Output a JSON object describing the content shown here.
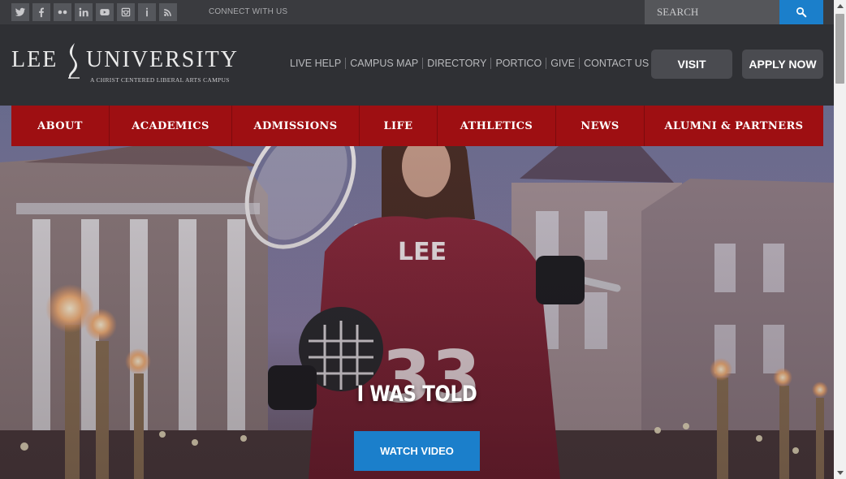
{
  "topbar": {
    "social_icons": [
      "twitter-icon",
      "facebook-icon",
      "flickr-icon",
      "linkedin-icon",
      "youtube-icon",
      "instagram-icon",
      "portico-icon",
      "rss-icon"
    ],
    "connect_label": "CONNECT WITH US",
    "search_placeholder": "SEARCH",
    "search_icon": "search-icon"
  },
  "header": {
    "logo_left": "LEE",
    "logo_right": "UNIVERSITY",
    "logo_tagline": "A CHRIST CENTERED LIBERAL ARTS CAMPUS",
    "links": [
      "LIVE HELP",
      "CAMPUS MAP",
      "DIRECTORY",
      "PORTICO",
      "GIVE",
      "CONTACT US"
    ],
    "visit_label": "VISIT",
    "apply_label": "APPLY NOW"
  },
  "nav": {
    "items": [
      "ABOUT",
      "ACADEMICS",
      "ADMISSIONS",
      "LIFE",
      "ATHLETICS",
      "NEWS",
      "ALUMNI & PARTNERS"
    ]
  },
  "hero": {
    "headline": "I WAS TOLD",
    "button_label": "WATCH VIDEO"
  },
  "colors": {
    "nav_red": "#9e0f12",
    "accent_blue": "#1b7fcb",
    "header_dark": "#2f3034"
  }
}
